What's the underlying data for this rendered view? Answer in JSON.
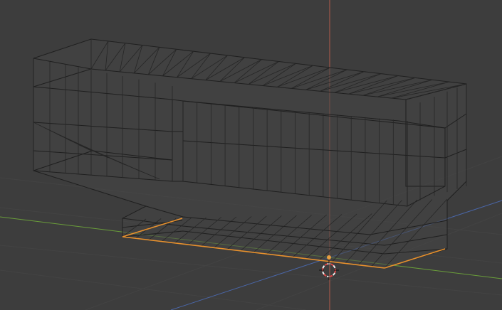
{
  "viewport": {
    "background": "#3d3d3d",
    "grid_color": "#434343",
    "wire_color": "#1f1f1f"
  },
  "axes": {
    "x_color": "#6a9e3a",
    "y_color": "#4a66a8",
    "z_color": "#b45a4a"
  },
  "selection": {
    "edge_color": "#e8912d",
    "origin_color": "#e8a040"
  },
  "cursor": {
    "icon": "3d-cursor-icon",
    "ring_color_a": "#e04848",
    "ring_color_b": "#f0f0f0"
  }
}
